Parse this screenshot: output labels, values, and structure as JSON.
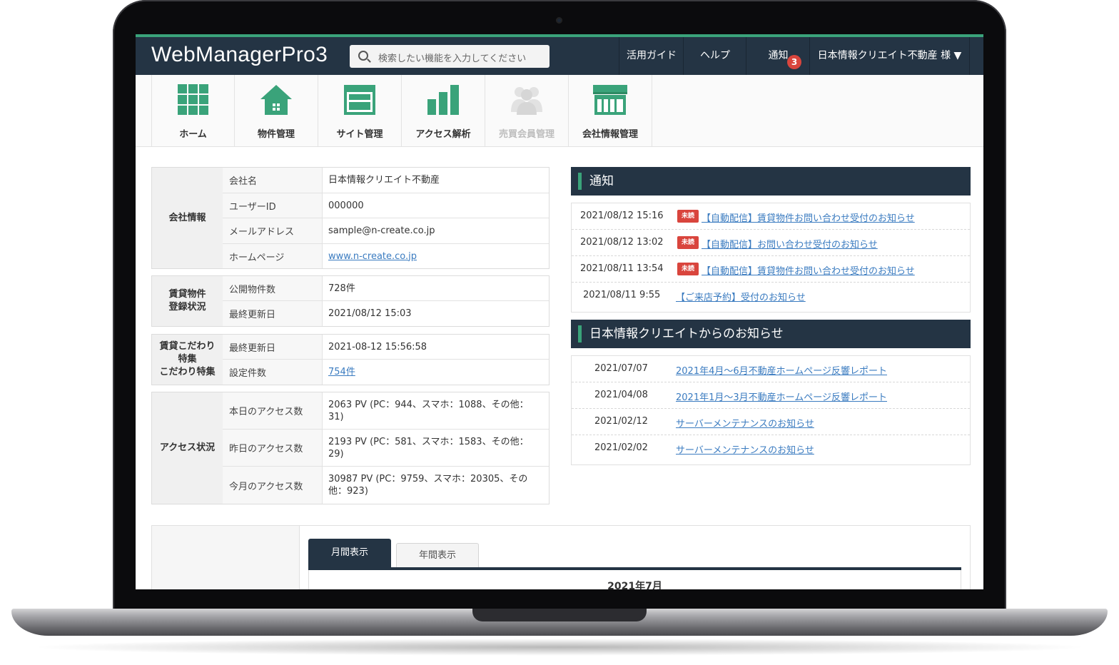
{
  "app": {
    "logo": "WebManagerPro3"
  },
  "search": {
    "placeholder": "検索したい機能を入力してください"
  },
  "topnav": {
    "guide": "活用ガイド",
    "help": "ヘルプ",
    "notice": "通知",
    "notice_count": "3",
    "user": "日本情報クリエイト不動産 様 ▼"
  },
  "iconnav": [
    {
      "label": "ホーム",
      "icon": "grid-icon",
      "enabled": true
    },
    {
      "label": "物件管理",
      "icon": "house-icon",
      "enabled": true
    },
    {
      "label": "サイト管理",
      "icon": "window-icon",
      "enabled": true
    },
    {
      "label": "アクセス解析",
      "icon": "bar-chart-icon",
      "enabled": true
    },
    {
      "label": "売買会員管理",
      "icon": "users-icon",
      "enabled": false
    },
    {
      "label": "会社情報管理",
      "icon": "storefront-icon",
      "enabled": true
    }
  ],
  "company": {
    "heading": "会社情報",
    "rows": [
      {
        "k": "会社名",
        "v": "日本情報クリエイト不動産"
      },
      {
        "k": "ユーザーID",
        "v": "000000"
      },
      {
        "k": "メールアドレス",
        "v": "sample@n-create.co.jp"
      },
      {
        "k": "ホームページ",
        "v": "www.n-create.co.jp"
      }
    ]
  },
  "rental": {
    "heading_line1": "賃貸物件",
    "heading_line2": "登録状況",
    "rows": [
      {
        "k": "公開物件数",
        "v": "728件"
      },
      {
        "k": "最終更新日",
        "v": "2021/08/12 15:03"
      }
    ]
  },
  "feature": {
    "heading_line1": "賃貸こだわり",
    "heading_line2": "特集",
    "heading_line3": "こだわり特集",
    "rows": [
      {
        "k": "最終更新日",
        "v": "2021-08-12 15:56:58"
      },
      {
        "k": "設定件数",
        "v": "754件"
      }
    ]
  },
  "access": {
    "heading": "アクセス状況",
    "rows": [
      {
        "k": "本日のアクセス数",
        "v": "2063 PV (PC：944、スマホ：1088、その他：31)"
      },
      {
        "k": "昨日のアクセス数",
        "v": "2193 PV (PC：581、スマホ：1583、その他：29)"
      },
      {
        "k": "今月のアクセス数",
        "v": "30987 PV (PC：9759、スマホ：20305、その他：923)"
      }
    ]
  },
  "notifications": {
    "title": "通知",
    "unread_label": "未読",
    "items": [
      {
        "date": "2021/08/12 15:16",
        "unread": true,
        "text": "【自動配信】賃貸物件お問い合わせ受付のお知らせ"
      },
      {
        "date": "2021/08/12 13:02",
        "unread": true,
        "text": "【自動配信】お問い合わせ受付のお知らせ"
      },
      {
        "date": "2021/08/11 13:54",
        "unread": true,
        "text": "【自動配信】賃貸物件お問い合わせ受付のお知らせ"
      },
      {
        "date": "2021/08/11 9:55",
        "unread": false,
        "text": "【ご来店予約】受付のお知らせ"
      }
    ]
  },
  "news": {
    "title": "日本情報クリエイトからのお知らせ",
    "items": [
      {
        "date": "2021/07/07",
        "text": "2021年4月～6月不動産ホームページ反響レポート"
      },
      {
        "date": "2021/04/08",
        "text": "2021年1月～3月不動産ホームページ反響レポート"
      },
      {
        "date": "2021/02/12",
        "text": "サーバーメンテナンスのお知らせ"
      },
      {
        "date": "2021/02/02",
        "text": "サーバーメンテナンスのお知らせ"
      }
    ]
  },
  "chart": {
    "tab_monthly": "月間表示",
    "tab_yearly": "年間表示",
    "period": "2021年7月"
  },
  "colors": {
    "navy": "#243444",
    "accent_green": "#3aa37a",
    "unread_red": "#d9453d",
    "link_blue": "#3a7bc0"
  }
}
